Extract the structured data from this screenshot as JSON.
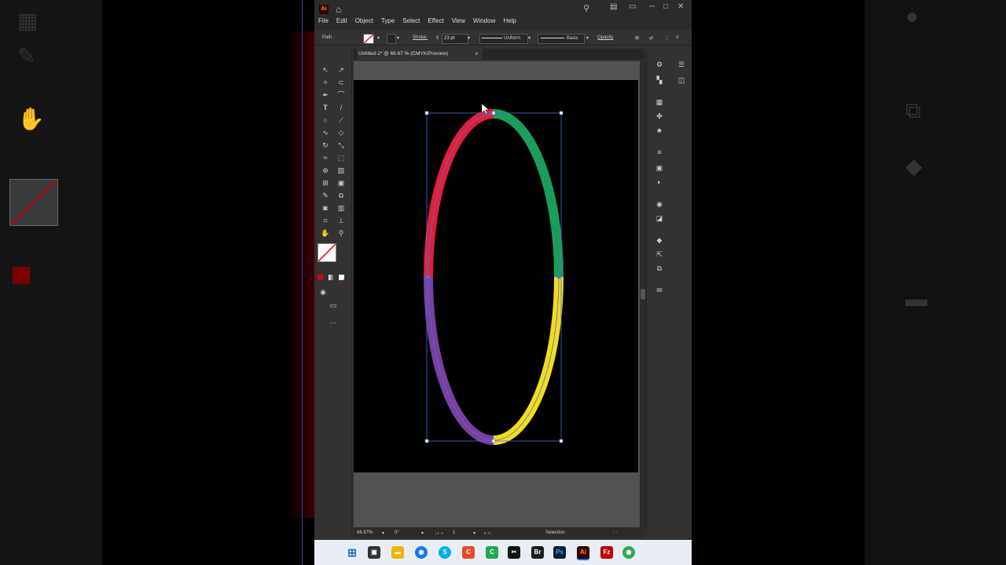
{
  "menubar": {
    "logo": "Ai",
    "menus": [
      "File",
      "Edit",
      "Object",
      "Type",
      "Select",
      "Effect",
      "View",
      "Window",
      "Help"
    ]
  },
  "controlbar": {
    "object_type": "Path",
    "stroke_label": "Stroke:",
    "stroke_weight": "23 pt",
    "profile_uniform": "Uniform",
    "brush_basic": "Basic",
    "opacity_label": "Opacity"
  },
  "document": {
    "tab_title": "Untitled-1* @ 66.67 % (CMYK/Preview)"
  },
  "statusbar": {
    "zoom": "66.67%",
    "rotation": "0°",
    "artboard_number": "1",
    "tool_name": "Selection"
  },
  "artwork": {
    "segment_colors": [
      "#e0203a",
      "#16a050",
      "#f2dc1e",
      "#7a3fa0"
    ],
    "selection_color": "#4a6fd8"
  },
  "taskbar": {
    "icons": [
      "windows-start",
      "file-explorer",
      "folder",
      "chrome",
      "skype",
      "capcut-red",
      "camtasia",
      "capcut",
      "bridge",
      "photoshop",
      "illustrator",
      "filezilla",
      "chrome-alt"
    ]
  }
}
